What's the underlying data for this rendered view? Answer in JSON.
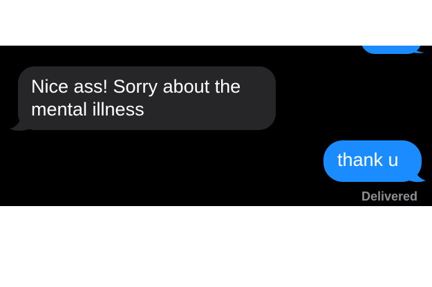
{
  "colors": {
    "background": "#000000",
    "received_bubble": "#262628",
    "sent_bubble": "#1a8cff",
    "status_text": "#8e8e93"
  },
  "messages": [
    {
      "direction": "received",
      "text": "Nice ass! Sorry about the mental illness"
    },
    {
      "direction": "sent",
      "text": "thank u"
    }
  ],
  "status": "Delivered"
}
